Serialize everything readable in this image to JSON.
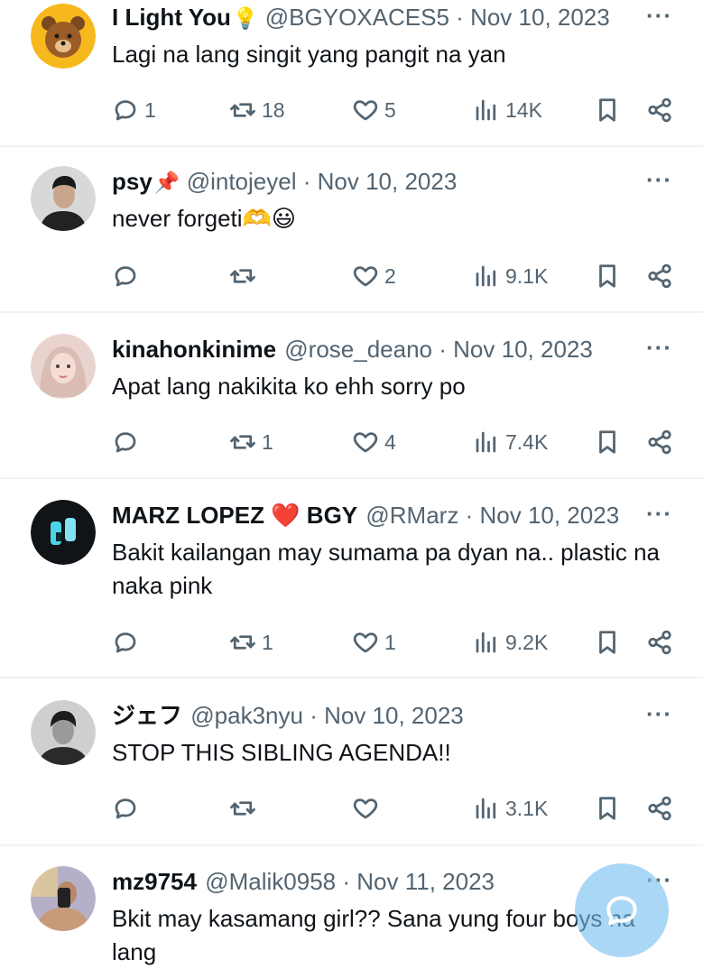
{
  "tweets": [
    {
      "name": "I Light You",
      "name_emoji": "💡",
      "handle": "@BGYOXACES5",
      "date": "Nov 10, 2023",
      "text": "Lagi na lang singit yang pangit na yan",
      "replies": "1",
      "retweets": "18",
      "likes": "5",
      "views": "14K"
    },
    {
      "name": "psy",
      "name_emoji": "📌",
      "handle": "@intojeyel",
      "date": "Nov 10, 2023",
      "text": "never forgeti🫶😃",
      "replies": "",
      "retweets": "",
      "likes": "2",
      "views": "9.1K"
    },
    {
      "name": "kinahonkinime",
      "name_emoji": "",
      "handle": "@rose_deano",
      "date": "Nov 10, 2023",
      "text": "Apat lang nakikita ko ehh sorry po",
      "replies": "",
      "retweets": "1",
      "likes": "4",
      "views": "7.4K"
    },
    {
      "name": "MARZ LOPEZ ❤️ BGY",
      "name_emoji": "",
      "handle": "@RMarz",
      "date": "Nov 10, 2023",
      "text": "Bakit kailangan may sumama pa dyan na.. plastic na naka pink",
      "replies": "",
      "retweets": "1",
      "likes": "1",
      "views": "9.2K"
    },
    {
      "name": "ジェフ",
      "name_emoji": "",
      "handle": "@pak3nyu",
      "date": "Nov 10, 2023",
      "text": "STOP THIS SIBLING AGENDA!!",
      "replies": "",
      "retweets": "",
      "likes": "",
      "views": "3.1K"
    },
    {
      "name": "mz9754",
      "name_emoji": "",
      "handle": "@Malik0958",
      "date": "Nov 11, 2023",
      "text": "Bkit may kasamang girl?? Sana yung four boys na lang",
      "replies": "",
      "retweets": "",
      "likes": "",
      "views": ""
    }
  ],
  "separator": "·",
  "more_label": "···",
  "icons": {
    "reply": "reply-icon",
    "retweet": "retweet-icon",
    "like": "heart-icon",
    "views": "views-icon",
    "bookmark": "bookmark-icon",
    "share": "share-icon",
    "compose": "compose-icon"
  },
  "colors": {
    "text": "#0f1419",
    "secondary": "#536471",
    "divider": "#eff3f4",
    "fab": "#78bef0"
  }
}
